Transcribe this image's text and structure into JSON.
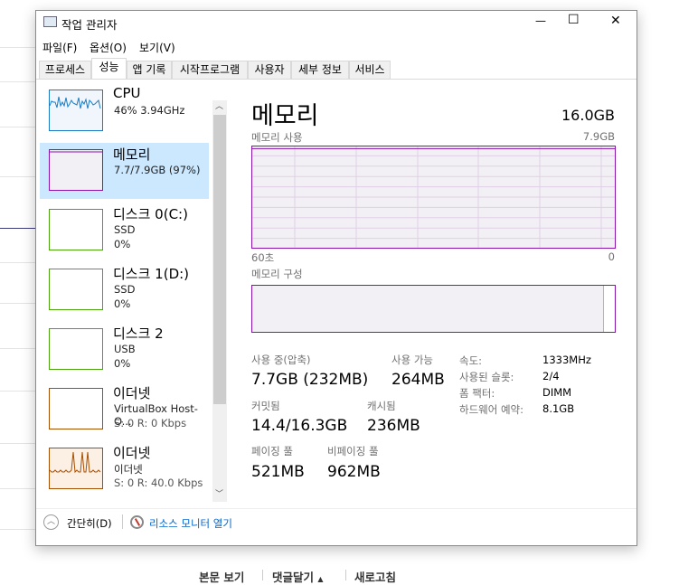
{
  "window": {
    "title": "작업 관리자",
    "controls": {
      "minimize": "—",
      "maximize": "☐",
      "close": "✕"
    }
  },
  "menu": [
    "파일(F)",
    "옵션(O)",
    "보기(V)"
  ],
  "tabs": [
    {
      "label": "프로세스"
    },
    {
      "label": "성능",
      "active": true
    },
    {
      "label": "앱 기록"
    },
    {
      "label": "시작프로그램"
    },
    {
      "label": "사용자"
    },
    {
      "label": "세부 정보"
    },
    {
      "label": "서비스"
    }
  ],
  "sidebar": [
    {
      "name": "CPU",
      "line1": "46% 3.94GHz",
      "color": "#1a7dc4"
    },
    {
      "name": "메모리",
      "line1": "7.7/7.9GB (97%)",
      "color": "#8b12ae",
      "selected": true
    },
    {
      "name": "디스크 0(C:)",
      "line1": "SSD",
      "line2": "0%",
      "color": "#4da60c"
    },
    {
      "name": "디스크 1(D:)",
      "line1": "SSD",
      "line2": "0%",
      "color": "#4da60c"
    },
    {
      "name": "디스크 2",
      "line1": "USB",
      "line2": "0%",
      "color": "#4da60c"
    },
    {
      "name": "이더넷",
      "line1": "VirtualBox Host-O...",
      "line2": "S: 0 R: 0 Kbps",
      "color": "#a74f01"
    },
    {
      "name": "이더넷",
      "line1": "이더넷",
      "line2": "S: 0 R: 40.0 Kbps",
      "color": "#a74f01"
    }
  ],
  "main": {
    "title": "메모리",
    "total": "16.0GB",
    "usage_label": "메모리 사용",
    "usage_max": "7.9GB",
    "time_left": "60초",
    "time_right": "0",
    "composition_label": "메모리 구성",
    "usage_percent": 97,
    "stats": {
      "in_use_label": "사용 중(압축)",
      "in_use": "7.7GB (232MB)",
      "available_label": "사용 가능",
      "available": "264MB",
      "committed_label": "커밋됨",
      "committed": "14.4/16.3GB",
      "cached_label": "캐시됨",
      "cached": "236MB",
      "paged_label": "페이징 풀",
      "paged": "521MB",
      "nonpaged_label": "비페이징 풀",
      "nonpaged": "962MB"
    },
    "specs": [
      {
        "k": "속도:",
        "v": "1333MHz"
      },
      {
        "k": "사용된 슬롯:",
        "v": "2/4"
      },
      {
        "k": "폼 팩터:",
        "v": "DIMM"
      },
      {
        "k": "하드웨어 예약:",
        "v": "8.1GB"
      }
    ]
  },
  "footer": {
    "fewer": "간단히(D)",
    "resmon": "리소스 모니터 열기"
  },
  "page_bottom": {
    "view": "본문 보기",
    "comment": "댓글달기",
    "comment_arrow": "▲",
    "refresh": "새로고침"
  }
}
